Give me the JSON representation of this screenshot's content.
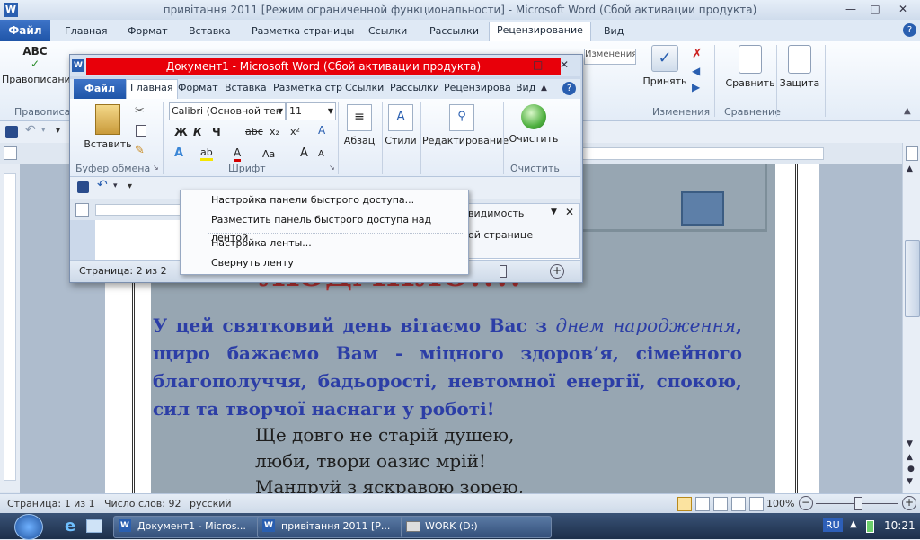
{
  "main_window": {
    "title": "привітання 2011 [Режим ограниченной функциональности]  -  Microsoft Word (Сбой активации продукта)",
    "tabs": [
      "Главная",
      "Формат",
      "Вставка",
      "Разметка страницы",
      "Ссылки",
      "Рассылки",
      "Рецензирование",
      "Вид"
    ],
    "file_tab": "Файл",
    "active_tab": "Рецензирование",
    "ribbon": {
      "spelling": "Правописание",
      "spelling_group": "Правописа",
      "accept": "Принять",
      "compare": "Сравнить",
      "protect": "Защита",
      "changes_group": "Изменения",
      "compare_group": "Сравнение",
      "combo_text": "Изменения с показом исправления"
    }
  },
  "document": {
    "heading_fragment": "ЛЮДМИЛО!!!!",
    "paragraph_line1": "У цей святковий день вітаємо Вас з",
    "paragraph_italic1": "днем",
    "paragraph_italic2": "народження",
    "paragraph_line2": ", щиро бажаємо Вам - міцного здоров’я,",
    "paragraph_line3": "сімейного благополуччя, бадьорості, невтомної енергії,",
    "paragraph_line4": "спокою, сил та творчої наснаги у роботі!",
    "poem_line1": "Ще довго не старій душею,",
    "poem_line2": "люби, твори оазис мрій!",
    "poem_line3": "Мандруй з яскравою зорею,"
  },
  "status_bar": {
    "page": "Страница: 1 из 1",
    "words": "Число слов: 92",
    "language": "русский",
    "zoom": "100%"
  },
  "second_window": {
    "title": "Документ1  -  Microsoft Word (Сбой активации продукта)",
    "file_tab": "Файл",
    "tabs": [
      "Главная",
      "Формат",
      "Вставка",
      "Разметка стр",
      "Ссылки",
      "Рассылки",
      "Рецензирова",
      "Вид"
    ],
    "font_name": "Calibri (Основной тек",
    "font_size": "11",
    "paste": "Вставить",
    "paragraph": "Абзац",
    "styles": "Стили",
    "editing": "Редактирование",
    "clear": "Очистить",
    "clipboard_group": "Буфер обмена",
    "font_group": "Шрифт",
    "clear_group": "Очистить",
    "bold": "Ж",
    "italic": "К",
    "underline": "Ч",
    "strikethrough": "abc",
    "subscript": "x₂",
    "superscript": "x²",
    "change_case": "Aa",
    "grow_font": "A",
    "shrink_font": "A",
    "status_page": "Страница: 2 из 2",
    "panel_title_fragment": "видимость",
    "panel_text_fragment": "ой странице"
  },
  "context_menu": {
    "items": [
      "Настройка панели быстрого доступа...",
      "Разместить панель быстрого доступа над лентой",
      "Настройка ленты...",
      "Свернуть ленту"
    ]
  },
  "taskbar": {
    "items": [
      "Документ1 - Micros...",
      "привітання 2011 [Р...",
      "WORK (D:)"
    ],
    "language": "RU",
    "clock": "10:21"
  },
  "colors": {
    "accent_red": "#e8000a",
    "file_tab_blue": "#2a5fb0",
    "doc_text_blue": "#2c3ea6",
    "heading_red": "#b73333"
  }
}
